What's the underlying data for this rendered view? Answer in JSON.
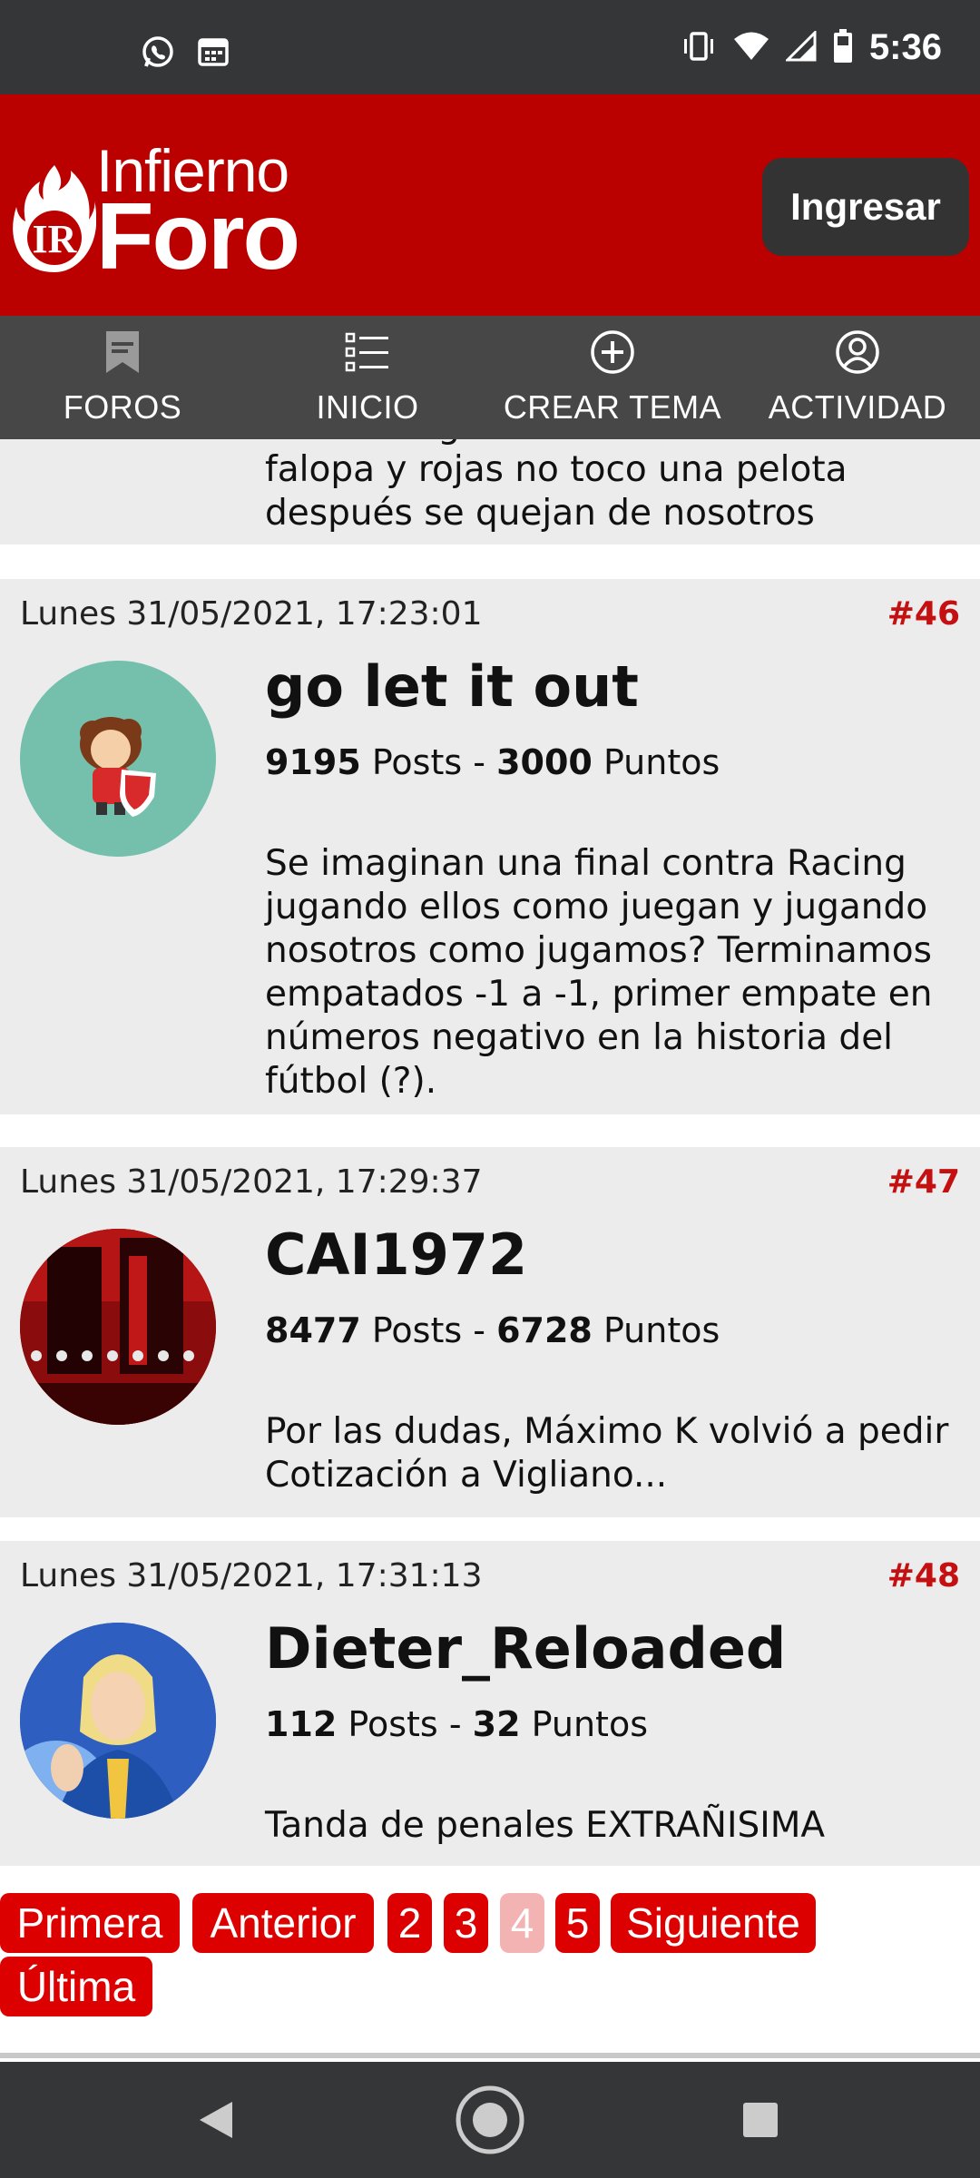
{
  "status_bar": {
    "time": "5:36",
    "left_icons": [
      "whatsapp-icon",
      "calendar-icon"
    ],
    "right_icons": [
      "vibrate-icon",
      "wifi-icon",
      "signal-icon",
      "battery-icon"
    ]
  },
  "header": {
    "logo_line1": "Infierno",
    "logo_line2": "Foro",
    "logo_emblem": "IR",
    "login_label": "Ingresar"
  },
  "nav": [
    {
      "label": "FOROS",
      "icon": "bookmark-icon"
    },
    {
      "label": "INICIO",
      "icon": "list-icon"
    },
    {
      "label": "CREAR TEMA",
      "icon": "plus-circle-icon"
    },
    {
      "label": "ACTIVIDAD",
      "icon": "user-circle-icon"
    }
  ],
  "previous_post": {
    "body_lines": [
      "Máxima figura en una colección",
      "falopa y rojas no toco una pelota",
      "después se quejan de nosotros"
    ]
  },
  "posts": [
    {
      "date": "Lunes 31/05/2021, 17:23:01",
      "number": "#46",
      "username": "go let it out",
      "posts_count": "9195",
      "posts_label": "Posts",
      "separator": "-",
      "points_count": "3000",
      "points_label": "Puntos",
      "body": "Se imaginan una final contra Racing jugando ellos como juegan y jugando nosotros como jugamos? Terminamos empatados -1 a -1, primer empate en números negativo en la historia del fútbol (?)."
    },
    {
      "date": "Lunes 31/05/2021, 17:29:37",
      "number": "#47",
      "username": "CAI1972",
      "posts_count": "8477",
      "posts_label": "Posts",
      "separator": "-",
      "points_count": "6728",
      "points_label": "Puntos",
      "body": "Por las dudas, Máximo K volvió a pedir Cotización a Vigliano..."
    },
    {
      "date": "Lunes 31/05/2021, 17:31:13",
      "number": "#48",
      "username": "Dieter_Reloaded",
      "posts_count": "112",
      "posts_label": "Posts",
      "separator": "-",
      "points_count": "32",
      "points_label": "Puntos",
      "body": "Tanda de penales EXTRAÑISIMA"
    }
  ],
  "pager": {
    "first": "Primera",
    "prev": "Anterior",
    "p2": "2",
    "p3": "3",
    "current": "4",
    "p5": "5",
    "next": "Siguiente",
    "last": "Última"
  },
  "colors": {
    "brand_red": "#bb0000",
    "button_red": "#dd0000",
    "post_number_red": "#c41010",
    "nav_bg": "#474747"
  }
}
